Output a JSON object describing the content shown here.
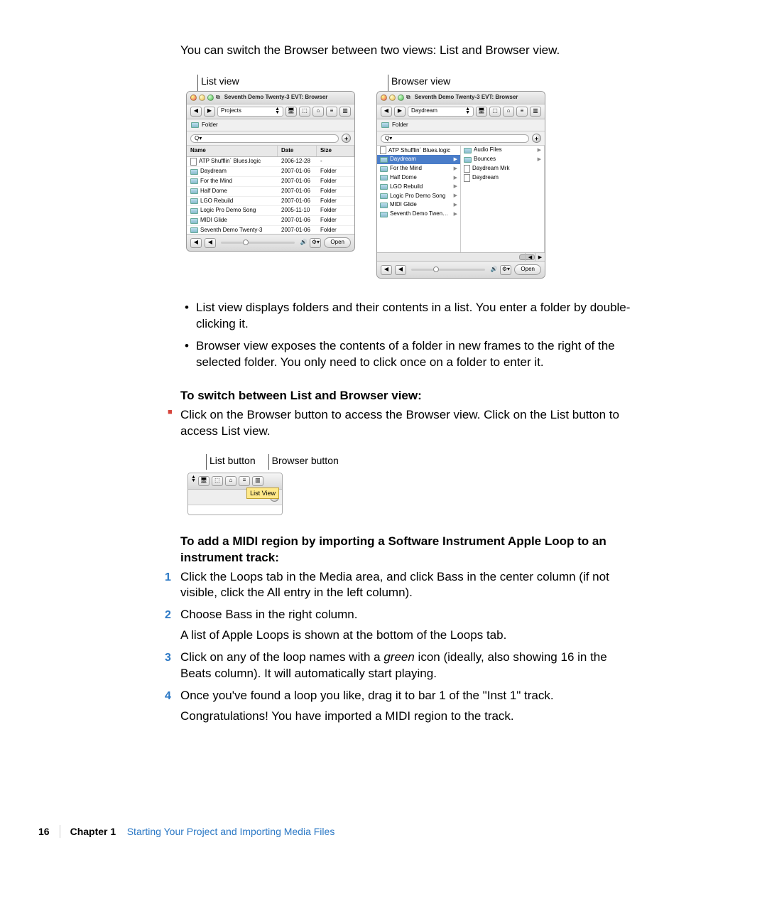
{
  "intro": "You can switch the Browser between two views: List and Browser view.",
  "shot_labels": {
    "list": "List view",
    "browser": "Browser view"
  },
  "windows": {
    "title": "Seventh Demo Twenty-3 EVT: Browser",
    "path_list": "Projects",
    "path_browser": "Daydream",
    "folder_label": "Folder",
    "search_glyph": "Q▾",
    "list_headers": {
      "name": "Name",
      "date": "Date",
      "size": "Size"
    },
    "open_label": "Open",
    "list_rows": [
      {
        "name": "ATP Shufflin´ Blues.logic",
        "date": "2006-12-28",
        "size": "-",
        "icon": "file"
      },
      {
        "name": "Daydream",
        "date": "2007-01-06",
        "size": "Folder",
        "icon": "folder"
      },
      {
        "name": "For the Mind",
        "date": "2007-01-06",
        "size": "Folder",
        "icon": "folder"
      },
      {
        "name": "Half Dome",
        "date": "2007-01-06",
        "size": "Folder",
        "icon": "folder"
      },
      {
        "name": "LGO Rebuild",
        "date": "2007-01-06",
        "size": "Folder",
        "icon": "folder"
      },
      {
        "name": "Logic Pro Demo Song",
        "date": "2005-11-10",
        "size": "Folder",
        "icon": "folder"
      },
      {
        "name": "MIDI Glide",
        "date": "2007-01-06",
        "size": "Folder",
        "icon": "folder"
      },
      {
        "name": "Seventh Demo Twenty-3",
        "date": "2007-01-06",
        "size": "Folder",
        "icon": "folder"
      }
    ],
    "browser_col1": [
      {
        "name": "ATP Shufflin´ Blues.logic",
        "icon": "file",
        "selected": false
      },
      {
        "name": "Daydream",
        "icon": "folder",
        "selected": true
      },
      {
        "name": "For the Mind",
        "icon": "folder",
        "selected": false
      },
      {
        "name": "Half Dome",
        "icon": "folder",
        "selected": false
      },
      {
        "name": "LGO Rebuild",
        "icon": "folder",
        "selected": false
      },
      {
        "name": "Logic Pro Demo Song",
        "icon": "folder",
        "selected": false
      },
      {
        "name": "MIDI Glide",
        "icon": "folder",
        "selected": false
      },
      {
        "name": "Seventh Demo Twen…",
        "icon": "folder",
        "selected": false
      }
    ],
    "browser_col2": [
      {
        "name": "Audio Files",
        "icon": "folder",
        "selected": false
      },
      {
        "name": "Bounces",
        "icon": "folder",
        "selected": false
      },
      {
        "name": "Daydream Mrk",
        "icon": "file",
        "selected": false
      },
      {
        "name": "Daydream",
        "icon": "file",
        "selected": false
      }
    ]
  },
  "bullets": [
    "List view displays folders and their contents in a list. You enter a folder by double-clicking it.",
    "Browser view exposes the contents of a folder in new frames to the right of the selected folder. You only need to click once on a folder to enter it."
  ],
  "heading_switch": "To switch between List and Browser view:",
  "step_switch": "Click on the Browser button to access the Browser view. Click on the List button to access List view.",
  "button_shot": {
    "list_label": "List button",
    "browser_label": "Browser button",
    "tooltip": "List View"
  },
  "heading_midi": "To add a MIDI region by importing a Software Instrument Apple Loop to an instrument track:",
  "steps": [
    {
      "text": "Click the Loops tab in the Media area, and click Bass in the center column (if not visible, click the All entry in the left column)."
    },
    {
      "text": "Choose Bass in the right column.",
      "note": "A list of Apple Loops is shown at the bottom of the Loops tab."
    },
    {
      "text_a": "Click on any of the loop names with a ",
      "em": "green",
      "text_b": " icon (ideally, also showing 16 in the Beats column). It will automatically start playing."
    },
    {
      "text": "Once you've found a loop you like, drag it to bar 1 of the \"Inst 1\" track.",
      "note": "Congratulations! You have imported a MIDI region to the track."
    }
  ],
  "footer": {
    "page": "16",
    "chapter": "Chapter 1",
    "title": "Starting Your Project and Importing Media Files"
  }
}
